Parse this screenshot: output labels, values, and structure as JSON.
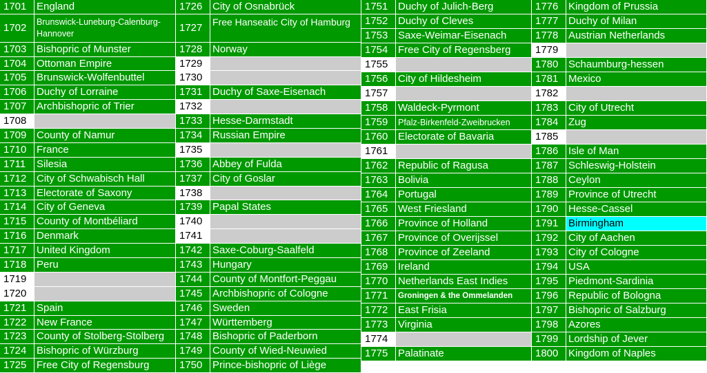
{
  "colors": {
    "filled": "#009900",
    "empty": "#cccccc",
    "highlight": "#00ffff"
  },
  "columns": [
    [
      {
        "year": "1701",
        "name": "England",
        "state": "filled"
      },
      {
        "year": "1702",
        "name": "Brunswick-Luneburg-Calenburg-Hannover",
        "state": "filled"
      },
      {
        "year": "1703",
        "name": "Bishopric of Munster",
        "state": "filled"
      },
      {
        "year": "1704",
        "name": "Ottoman Empire",
        "state": "filled"
      },
      {
        "year": "1705",
        "name": "Brunswick-Wolfenbuttel",
        "state": "filled"
      },
      {
        "year": "1706",
        "name": "Duchy of Lorraine",
        "state": "filled"
      },
      {
        "year": "1707",
        "name": "Archbishopric of Trier",
        "state": "filled"
      },
      {
        "year": "1708",
        "name": "",
        "state": "empty"
      },
      {
        "year": "1709",
        "name": "County of Namur",
        "state": "filled"
      },
      {
        "year": "1710",
        "name": "France",
        "state": "filled"
      },
      {
        "year": "1711",
        "name": "Silesia",
        "state": "filled"
      },
      {
        "year": "1712",
        "name": "City of Schwabisch Hall",
        "state": "filled"
      },
      {
        "year": "1713",
        "name": "Electorate of Saxony",
        "state": "filled"
      },
      {
        "year": "1714",
        "name": "City of Geneva",
        "state": "filled"
      },
      {
        "year": "1715",
        "name": "County of Montbéliard",
        "state": "filled"
      },
      {
        "year": "1716",
        "name": "Denmark",
        "state": "filled"
      },
      {
        "year": "1717",
        "name": "United Kingdom",
        "state": "filled"
      },
      {
        "year": "1718",
        "name": "Peru",
        "state": "filled"
      },
      {
        "year": "1719",
        "name": "",
        "state": "empty"
      },
      {
        "year": "1720",
        "name": "",
        "state": "empty"
      },
      {
        "year": "1721",
        "name": "Spain",
        "state": "filled"
      },
      {
        "year": "1722",
        "name": "New France",
        "state": "filled"
      },
      {
        "year": "1723",
        "name": "County of Stolberg-Stolberg",
        "state": "filled"
      },
      {
        "year": "1724",
        "name": "Bishopric of Würzburg",
        "state": "filled"
      },
      {
        "year": "1725",
        "name": "Free City of Regensburg",
        "state": "filled"
      }
    ],
    [
      {
        "year": "1726",
        "name": "City of Osnabrück",
        "state": "filled"
      },
      {
        "year": "1727",
        "name": "Free Hanseatic City of Hamburg",
        "state": "filled"
      },
      {
        "year": "1728",
        "name": "Norway",
        "state": "filled"
      },
      {
        "year": "1729",
        "name": "",
        "state": "empty"
      },
      {
        "year": "1730",
        "name": "",
        "state": "empty"
      },
      {
        "year": "1731",
        "name": "Duchy of Saxe-Eisenach",
        "state": "filled"
      },
      {
        "year": "1732",
        "name": "",
        "state": "empty"
      },
      {
        "year": "1733",
        "name": "Hesse-Darmstadt",
        "state": "filled"
      },
      {
        "year": "1734",
        "name": "Russian Empire",
        "state": "filled"
      },
      {
        "year": "1735",
        "name": "",
        "state": "empty"
      },
      {
        "year": "1736",
        "name": "Abbey of Fulda",
        "state": "filled"
      },
      {
        "year": "1737",
        "name": "City of Goslar",
        "state": "filled"
      },
      {
        "year": "1738",
        "name": "",
        "state": "empty"
      },
      {
        "year": "1739",
        "name": "Papal States",
        "state": "filled"
      },
      {
        "year": "1740",
        "name": "",
        "state": "empty"
      },
      {
        "year": "1741",
        "name": "",
        "state": "empty"
      },
      {
        "year": "1742",
        "name": "Saxe-Coburg-Saalfeld",
        "state": "filled"
      },
      {
        "year": "1743",
        "name": "Hungary",
        "state": "filled"
      },
      {
        "year": "1744",
        "name": "County of Montfort-Peggau",
        "state": "filled"
      },
      {
        "year": "1745",
        "name": "Archbishopric of Cologne",
        "state": "filled"
      },
      {
        "year": "1746",
        "name": "Sweden",
        "state": "filled"
      },
      {
        "year": "1747",
        "name": "Württemberg",
        "state": "filled"
      },
      {
        "year": "1748",
        "name": "Bishopric of Paderborn",
        "state": "filled"
      },
      {
        "year": "1749",
        "name": "County of Wied-Neuwied",
        "state": "filled"
      },
      {
        "year": "1750",
        "name": "Prince-bishopric of Liège",
        "state": "filled"
      }
    ],
    [
      {
        "year": "1751",
        "name": "Duchy of Julich-Berg",
        "state": "filled"
      },
      {
        "year": "1752",
        "name": "Duchy of Cleves",
        "state": "filled"
      },
      {
        "year": "1753",
        "name": "Saxe-Weimar-Eisenach",
        "state": "filled"
      },
      {
        "year": "1754",
        "name": "Free City of Regensberg",
        "state": "filled"
      },
      {
        "year": "1755",
        "name": "",
        "state": "empty"
      },
      {
        "year": "1756",
        "name": "City of Hildesheim",
        "state": "filled"
      },
      {
        "year": "1757",
        "name": "",
        "state": "empty"
      },
      {
        "year": "1758",
        "name": "Waldeck-Pyrmont",
        "state": "filled"
      },
      {
        "year": "1759",
        "name": "Pfalz-Birkenfeld-Zweibrucken",
        "state": "filled"
      },
      {
        "year": "1760",
        "name": "Electorate of Bavaria",
        "state": "filled"
      },
      {
        "year": "1761",
        "name": "",
        "state": "empty"
      },
      {
        "year": "1762",
        "name": "Republic of Ragusa",
        "state": "filled"
      },
      {
        "year": "1763",
        "name": "Bolivia",
        "state": "filled"
      },
      {
        "year": "1764",
        "name": "Portugal",
        "state": "filled"
      },
      {
        "year": "1765",
        "name": "West Friesland",
        "state": "filled"
      },
      {
        "year": "1766",
        "name": "Province of Holland",
        "state": "filled"
      },
      {
        "year": "1767",
        "name": "Province of Overijssel",
        "state": "filled"
      },
      {
        "year": "1768",
        "name": "Province of Zeeland",
        "state": "filled"
      },
      {
        "year": "1769",
        "name": "Ireland",
        "state": "filled"
      },
      {
        "year": "1770",
        "name": "Netherlands East Indies",
        "state": "filled"
      },
      {
        "year": "1771",
        "name": "Groningen & the Ommelanden",
        "state": "filled"
      },
      {
        "year": "1772",
        "name": "East Frisia",
        "state": "filled"
      },
      {
        "year": "1773",
        "name": "Virginia",
        "state": "filled"
      },
      {
        "year": "1774",
        "name": "",
        "state": "empty"
      },
      {
        "year": "1775",
        "name": "Palatinate",
        "state": "filled"
      }
    ],
    [
      {
        "year": "1776",
        "name": "Kingdom of Prussia",
        "state": "filled"
      },
      {
        "year": "1777",
        "name": "Duchy of Milan",
        "state": "filled"
      },
      {
        "year": "1778",
        "name": "Austrian Netherlands",
        "state": "filled"
      },
      {
        "year": "1779",
        "name": "",
        "state": "empty"
      },
      {
        "year": "1780",
        "name": "Schaumburg-hessen",
        "state": "filled"
      },
      {
        "year": "1781",
        "name": "Mexico",
        "state": "filled"
      },
      {
        "year": "1782",
        "name": "",
        "state": "empty"
      },
      {
        "year": "1783",
        "name": "City of Utrecht",
        "state": "filled"
      },
      {
        "year": "1784",
        "name": "Zug",
        "state": "filled"
      },
      {
        "year": "1785",
        "name": "",
        "state": "empty"
      },
      {
        "year": "1786",
        "name": "Isle of Man",
        "state": "filled"
      },
      {
        "year": "1787",
        "name": "Schleswig-Holstein",
        "state": "filled"
      },
      {
        "year": "1788",
        "name": "Ceylon",
        "state": "filled"
      },
      {
        "year": "1789",
        "name": "Province of Utrecht",
        "state": "filled"
      },
      {
        "year": "1790",
        "name": "Hesse-Cassel",
        "state": "filled"
      },
      {
        "year": "1791",
        "name": "Birmingham",
        "state": "highlight"
      },
      {
        "year": "1792",
        "name": "City of Aachen",
        "state": "filled"
      },
      {
        "year": "1793",
        "name": "City of Cologne",
        "state": "filled"
      },
      {
        "year": "1794",
        "name": "USA",
        "state": "filled"
      },
      {
        "year": "1795",
        "name": "Piedmont-Sardinia",
        "state": "filled"
      },
      {
        "year": "1796",
        "name": "Republic of Bologna",
        "state": "filled"
      },
      {
        "year": "1797",
        "name": "Bishopric of Salzburg",
        "state": "filled"
      },
      {
        "year": "1798",
        "name": "Azores",
        "state": "filled"
      },
      {
        "year": "1799",
        "name": "Lordship of Jever",
        "state": "filled"
      },
      {
        "year": "1800",
        "name": "Kingdom of Naples",
        "state": "filled"
      }
    ]
  ]
}
